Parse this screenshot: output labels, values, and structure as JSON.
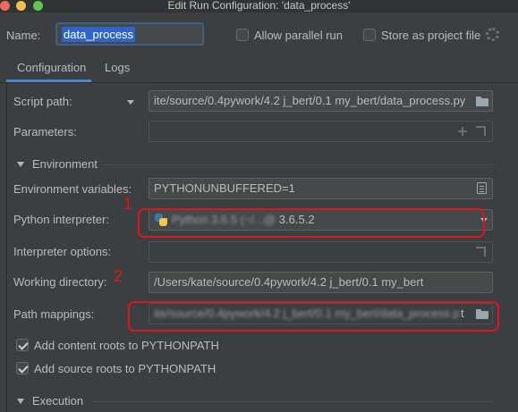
{
  "window": {
    "title": "Edit Run Configuration: 'data_process'"
  },
  "header": {
    "name_label": "Name:",
    "name_value": "data_process",
    "allow_parallel_label": "Allow parallel run",
    "store_project_label": "Store as project file"
  },
  "tabs": [
    {
      "label": "Configuration",
      "active": true
    },
    {
      "label": "Logs",
      "active": false
    }
  ],
  "form": {
    "script_path_label": "Script path:",
    "script_path_value": "ite/source/0.4pywork/4.2 j_bert/0.1 my_bert/data_process.py",
    "parameters_label": "Parameters:",
    "parameters_value": "",
    "environment_section": "Environment",
    "env_vars_label": "Environment variables:",
    "env_vars_value": "PYTHONUNBUFFERED=1",
    "interpreter_label": "Python interpreter:",
    "interpreter_value_obscured": "Python 3.6.5 (~/...@ ",
    "interpreter_value_suffix": "3.6.5.2",
    "interpreter_options_label": "Interpreter options:",
    "interpreter_options_value": "",
    "working_dir_label": "Working directory:",
    "working_dir_value": "/Users/kate/source/0.4pywork/4.2 j_bert/0.1 my_bert",
    "path_mappings_label": "Path mappings:",
    "path_mappings_value_obscured": "ite/source/0.4pywork/4.2 j_bert/0.1 my_bert/data_process.p",
    "path_mappings_value_suffix": "t",
    "add_content_roots_label": "Add content roots to PYTHONPATH",
    "add_content_roots_checked": true,
    "add_source_roots_label": "Add source roots to PYTHONPATH",
    "add_source_roots_checked": true,
    "execution_section": "Execution"
  },
  "annotations": [
    {
      "number": "1",
      "color": "#e0141b"
    },
    {
      "number": "2",
      "color": "#e0141b"
    }
  ],
  "colors": {
    "background": "#3c3f41",
    "field_background": "#45494a",
    "selection": "#2f65ca",
    "tab_accent": "#4a88c7",
    "annotation": "#e0141b"
  }
}
